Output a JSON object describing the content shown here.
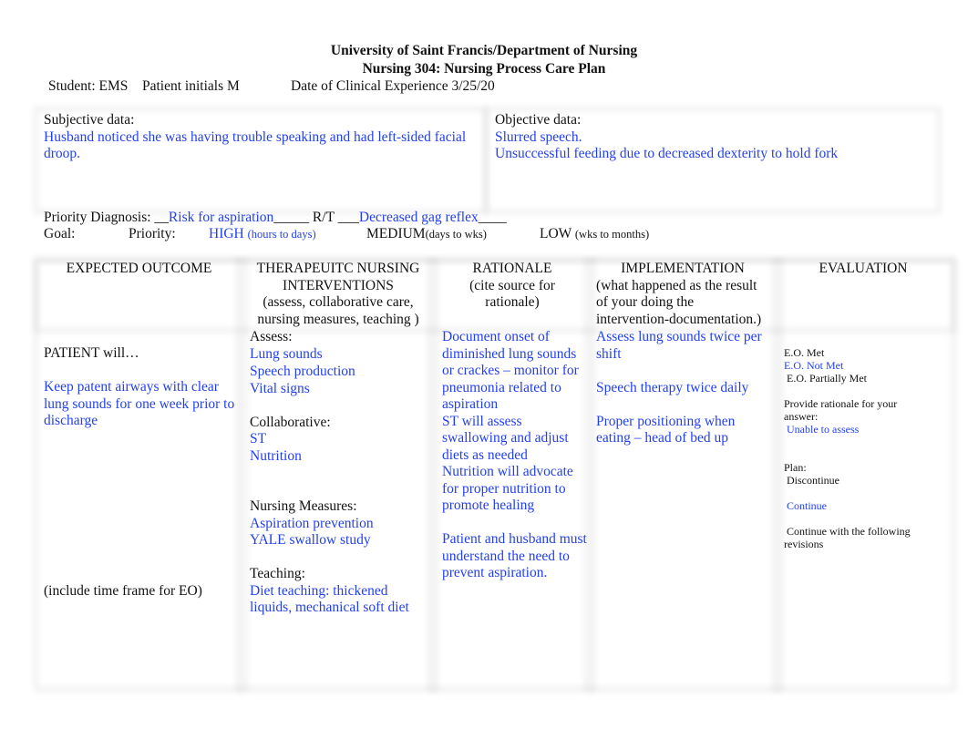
{
  "header": {
    "institution": "University of Saint Francis/Department of Nursing",
    "course": "Nursing 304: Nursing Process Care Plan",
    "student_label": "Student: EMS",
    "patient_label": "Patient initials M",
    "date_label": "Date of Clinical Experience 3/25/20"
  },
  "subjective": {
    "label": "Subjective data:",
    "text": "Husband noticed she was having trouble speaking and had left-sided facial droop."
  },
  "objective": {
    "label": "Objective data:",
    "lines": [
      "Slurred speech.",
      "Unsuccessful feeding due to decreased dexterity to hold fork"
    ]
  },
  "diagnosis": {
    "label": "Priority Diagnosis: __",
    "value": "Risk for aspiration",
    "rt_label": "_____ R/T ___",
    "rt_value": "Decreased gag reflex",
    "trail": "____"
  },
  "goal": {
    "label": "Goal:",
    "priority_label": "Priority:",
    "high": "HIGH",
    "high_note": "(hours to days)",
    "medium": "MEDIUM",
    "medium_note": "(days to wks)",
    "low": "LOW",
    "low_note": "(wks to months)"
  },
  "table": {
    "headers": {
      "outcome": "EXPECTED OUTCOME",
      "interventions_1": "THERAPEUITC NURSING",
      "interventions_2": "INTERVENTIONS",
      "interventions_3": "(assess, collaborative care,",
      "interventions_4": "nursing measures, teaching )",
      "rationale_1": "RATIONALE",
      "rationale_2": "(cite source for",
      "rationale_3": "rationale)",
      "implementation_1": "IMPLEMENTATION",
      "implementation_2": "(what happened as the result",
      "implementation_3": "of your doing the",
      "implementation_4": "intervention-documentation.)",
      "evaluation": "EVALUATION"
    },
    "outcome": {
      "lead": "PATIENT will…",
      "text": "Keep patent airways with clear lung sounds for one week prior to discharge",
      "footer": "(include time frame for EO)"
    },
    "interventions": {
      "assess_label": "Assess:",
      "assess_items": [
        "Lung sounds",
        "Speech production",
        "Vital signs"
      ],
      "collab_label": "Collaborative:",
      "collab_items": [
        "ST",
        "Nutrition"
      ],
      "measures_label": "Nursing Measures:",
      "measures_items": [
        "Aspiration prevention",
        "YALE swallow study"
      ],
      "teaching_label": "Teaching:",
      "teaching_text": "Diet teaching: thickened liquids, mechanical soft diet"
    },
    "rationale": {
      "items": [
        "Document onset of diminished lung sounds or crackes – monitor for pneumonia related to aspiration",
        "ST will assess swallowing and adjust diets as needed",
        "Nutrition will advocate for proper nutrition to promote healing",
        "Patient and husband must understand the need to prevent aspiration."
      ]
    },
    "implementation": {
      "items": [
        "Assess lung sounds twice per shift",
        "Speech therapy twice daily",
        "Proper positioning when eating – head of bed up"
      ]
    },
    "evaluation": {
      "met": "E.O. Met",
      "not_met": "E.O. Not Met",
      "partially_met": "E.O. Partially Met",
      "rationale_label": "Provide rationale for your answer:",
      "rationale_value": "Unable to assess",
      "plan_label": "Plan:",
      "discontinue": "Discontinue",
      "continue": "Continue",
      "continue_revisions": "Continue with the following revisions"
    }
  },
  "colors": {
    "entered_text": "#2340f0",
    "form_text": "#111111"
  }
}
